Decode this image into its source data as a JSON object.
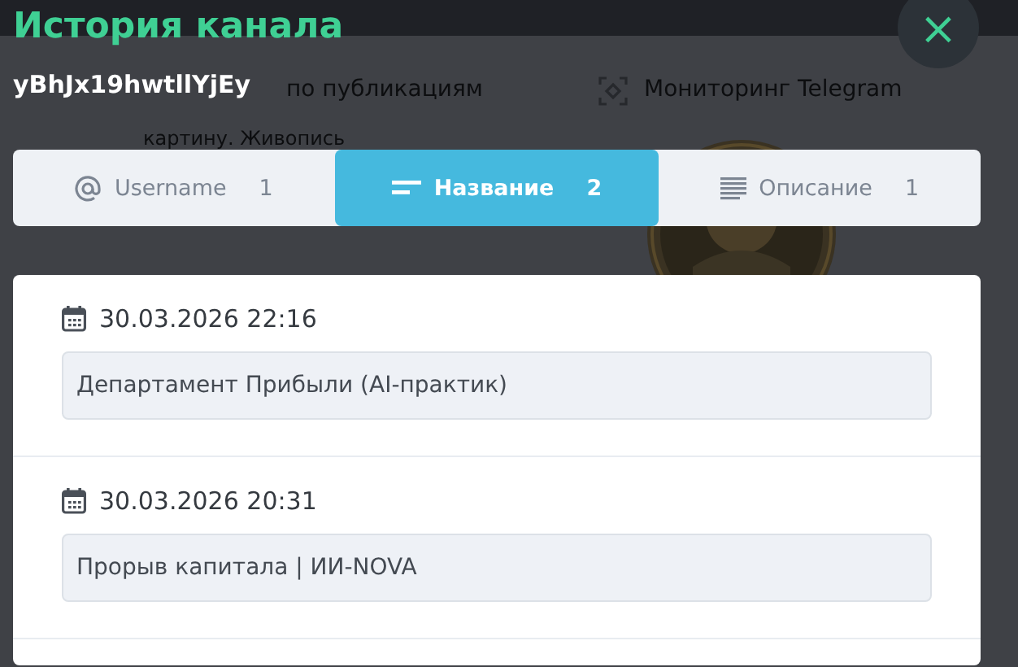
{
  "background": {
    "texts": [
      "по публикациям",
      "Мониторинг Telegram",
      "картину. Живопись"
    ]
  },
  "modal": {
    "title": "История канала",
    "close": "×",
    "username": "yBhJx19hwtllYjEy"
  },
  "tabs": [
    {
      "kind": "at",
      "label": "Username",
      "count": "1",
      "selected": false
    },
    {
      "kind": "lines",
      "label": "Название",
      "count": "2",
      "selected": true
    },
    {
      "kind": "text",
      "label": "Описание",
      "count": "1",
      "selected": false
    }
  ],
  "entries": [
    {
      "date": "30.03.2026 22:16",
      "value": "Департамент Прибыли (AI-практик)"
    },
    {
      "date": "30.03.2026 20:31",
      "value": "Прорыв капитала | ИИ-NOVA"
    }
  ]
}
